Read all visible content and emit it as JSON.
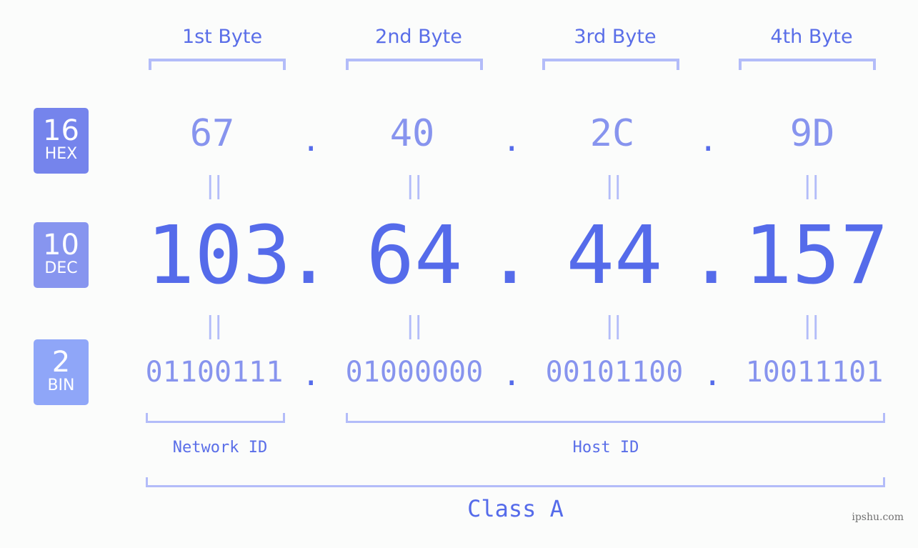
{
  "bases": [
    {
      "num": "16",
      "label": "HEX",
      "color": "#7584ec"
    },
    {
      "num": "10",
      "label": "DEC",
      "color": "#8795ef"
    },
    {
      "num": "2",
      "label": "BIN",
      "color": "#8fa6f8"
    }
  ],
  "byte_headers": [
    "1st Byte",
    "2nd Byte",
    "3rd Byte",
    "4th Byte"
  ],
  "hex": [
    "67",
    "40",
    "2C",
    "9D"
  ],
  "dec": [
    "103",
    "64",
    "44",
    "157"
  ],
  "bin": [
    "01100111",
    "01000000",
    "00101100",
    "10011101"
  ],
  "separator": ".",
  "equals": "||",
  "network_id_label": "Network ID",
  "host_id_label": "Host ID",
  "class_label": "Class A",
  "watermark": "ipshu.com",
  "colors": {
    "accent": "#556bea",
    "light": "#8794ee",
    "bracket": "#b3bcf9"
  }
}
